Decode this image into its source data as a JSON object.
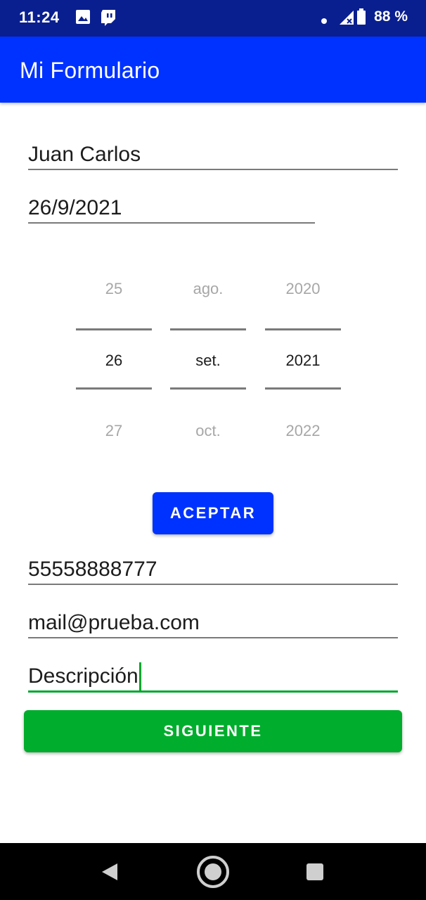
{
  "status_bar": {
    "time": "11:24",
    "battery": "88 %",
    "icons": [
      "image-notification-icon",
      "twitch-icon",
      "dot-icon",
      "signal-icon",
      "battery-icon"
    ]
  },
  "app_bar": {
    "title": "Mi Formulario"
  },
  "form": {
    "name_value": "Juan Carlos",
    "date_value": "26/9/2021",
    "phone_value": "55558888777",
    "email_value": "mail@prueba.com",
    "description_value": "Descripción"
  },
  "date_picker": {
    "day": {
      "prev": "25",
      "selected": "26",
      "next": "27"
    },
    "month": {
      "prev": "ago.",
      "selected": "set.",
      "next": "oct."
    },
    "year": {
      "prev": "2020",
      "selected": "2021",
      "next": "2022"
    }
  },
  "buttons": {
    "accept_label": "ACEPTAR",
    "next_label": "SIGUIENTE"
  },
  "colors": {
    "status_bar": "#0a1f8f",
    "app_bar": "#0032ff",
    "accent_green": "#00ad2c"
  }
}
